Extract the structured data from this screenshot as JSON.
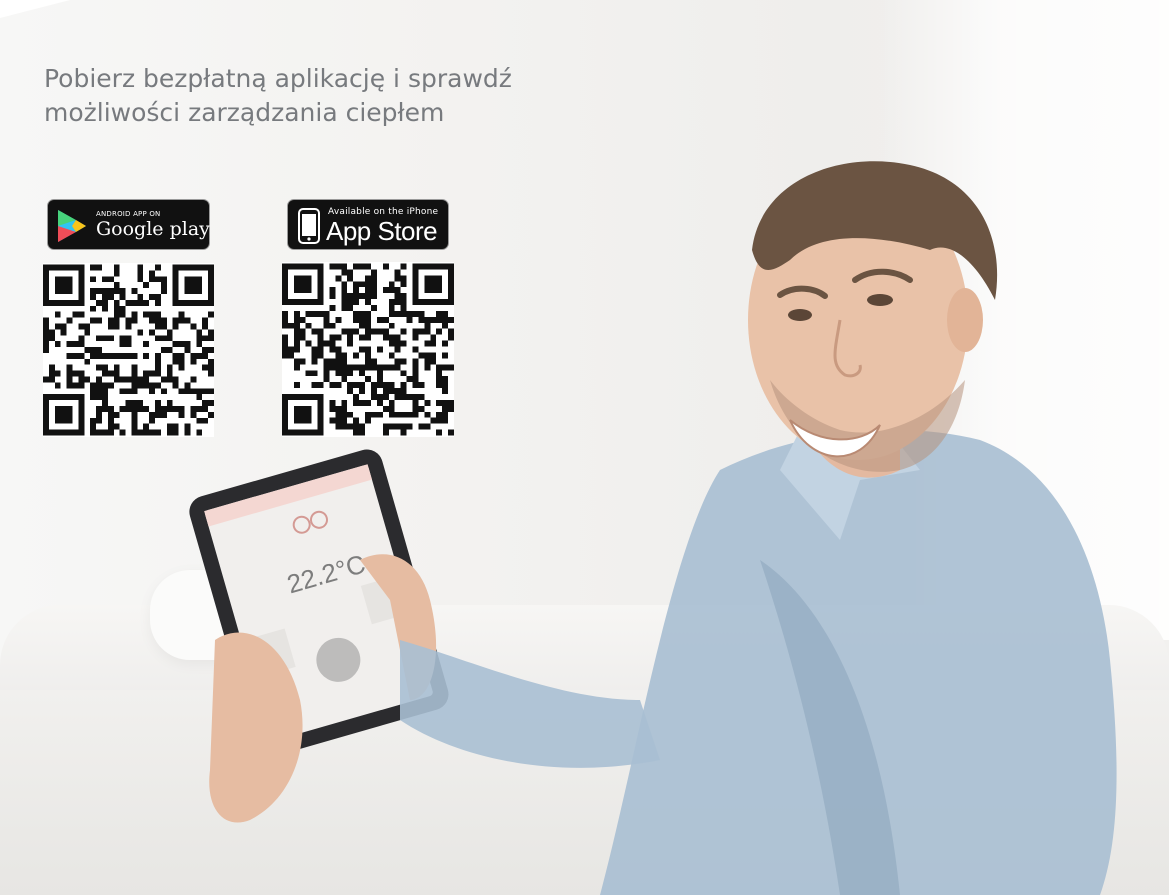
{
  "headline": {
    "line1": "Pobierz bezpłatną aplikację i sprawdź",
    "line2": "możliwości zarządzania ciepłem"
  },
  "stores": {
    "google": {
      "small_text": "ANDROID APP ON",
      "name": "Google play",
      "icon": "google-play-triangle-icon"
    },
    "apple": {
      "small_text": "Available on the iPhone",
      "name": "App Store",
      "icon": "iphone-icon"
    }
  },
  "tablet_screen": {
    "temperature": "22.2°C"
  },
  "colors": {
    "headline": "#777a7e",
    "badge_bg": "#111111",
    "background": "#f4f3f1"
  }
}
